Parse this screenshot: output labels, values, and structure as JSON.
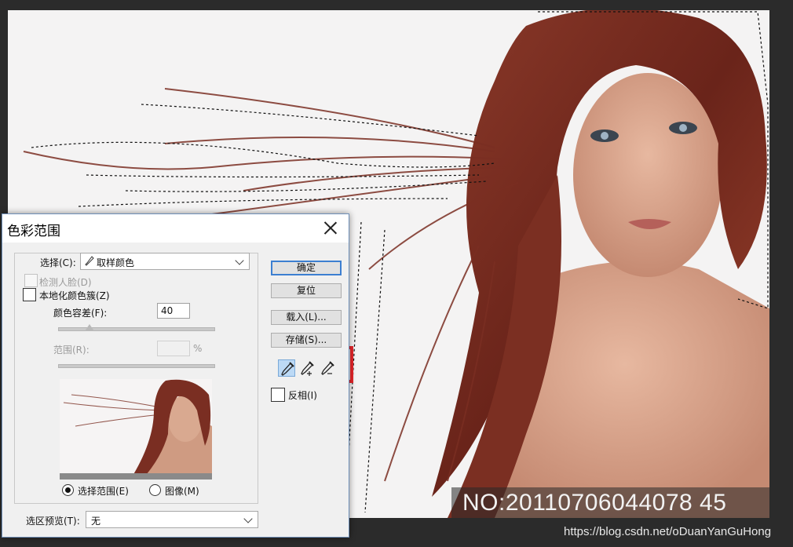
{
  "dialog": {
    "title": "色彩范围",
    "select_label": "选择(C):",
    "select_value": "取样颜色",
    "detect_faces_label": "检测人脸(D)",
    "localized_clusters_label": "本地化颜色簇(Z)",
    "fuzziness_label": "颜色容差(F):",
    "fuzziness_value": "40",
    "range_label": "范围(R):",
    "range_unit": "%",
    "radio_selection_label": "选择范围(E)",
    "radio_image_label": "图像(M)",
    "selection_preview_label": "选区预览(T):",
    "selection_preview_value": "无",
    "buttons": {
      "ok": "确定",
      "reset": "复位",
      "load": "载入(L)...",
      "save": "存储(S)..."
    },
    "invert_label": "反相(I)",
    "eyedroppers": [
      "eyedropper-icon",
      "eyedropper-plus-icon",
      "eyedropper-minus-icon"
    ],
    "state": {
      "detect_faces_checked": false,
      "localized_clusters_checked": false,
      "invert_checked": false,
      "selected_radio": "selection",
      "fuzziness_fraction": 0.2
    }
  },
  "canvas": {
    "watermark": "NO:20110706044078 45",
    "site_credit": "https://blog.csdn.net/oDuanYanGuHong"
  },
  "colors": {
    "highlight_frame": "#e8262b",
    "hair": "#7a2e22",
    "default_button_border": "#3c7fd1"
  }
}
